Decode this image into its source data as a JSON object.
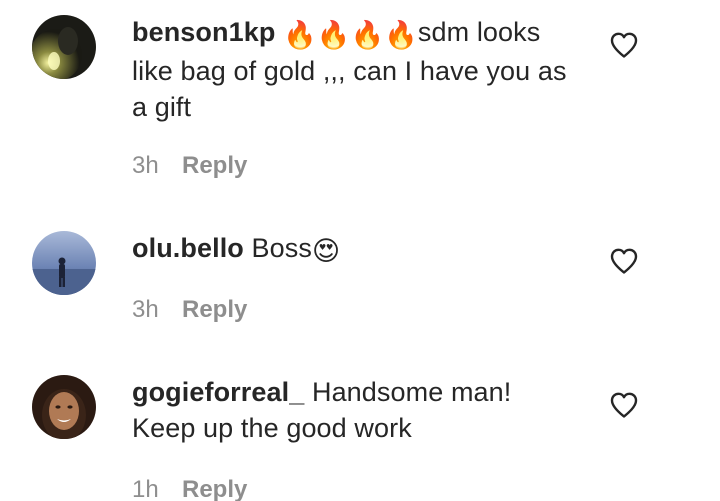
{
  "comments": [
    {
      "username": "benson1kp",
      "emoji_prefix": "🔥🔥🔥🔥",
      "text": "sdm looks like bag of gold ,,, can I have you as a gift",
      "time": "3h",
      "reply_label": "Reply",
      "avatar_icon": "avatar-photo-icon",
      "like_icon": "heart-outline-icon"
    },
    {
      "username": "olu.bello",
      "text": "Boss",
      "emoji_suffix": "😍",
      "time": "3h",
      "reply_label": "Reply",
      "avatar_icon": "avatar-photo-icon",
      "like_icon": "heart-outline-icon"
    },
    {
      "username": "gogieforreal_",
      "text": "Handsome man! Keep up the good work",
      "time": "1h",
      "reply_label": "Reply",
      "avatar_icon": "avatar-photo-icon",
      "like_icon": "heart-outline-icon"
    }
  ],
  "colors": {
    "text": "#262626",
    "meta": "#8e8e8e",
    "fire": "#ff6a00",
    "heart_outline": "#262626"
  }
}
